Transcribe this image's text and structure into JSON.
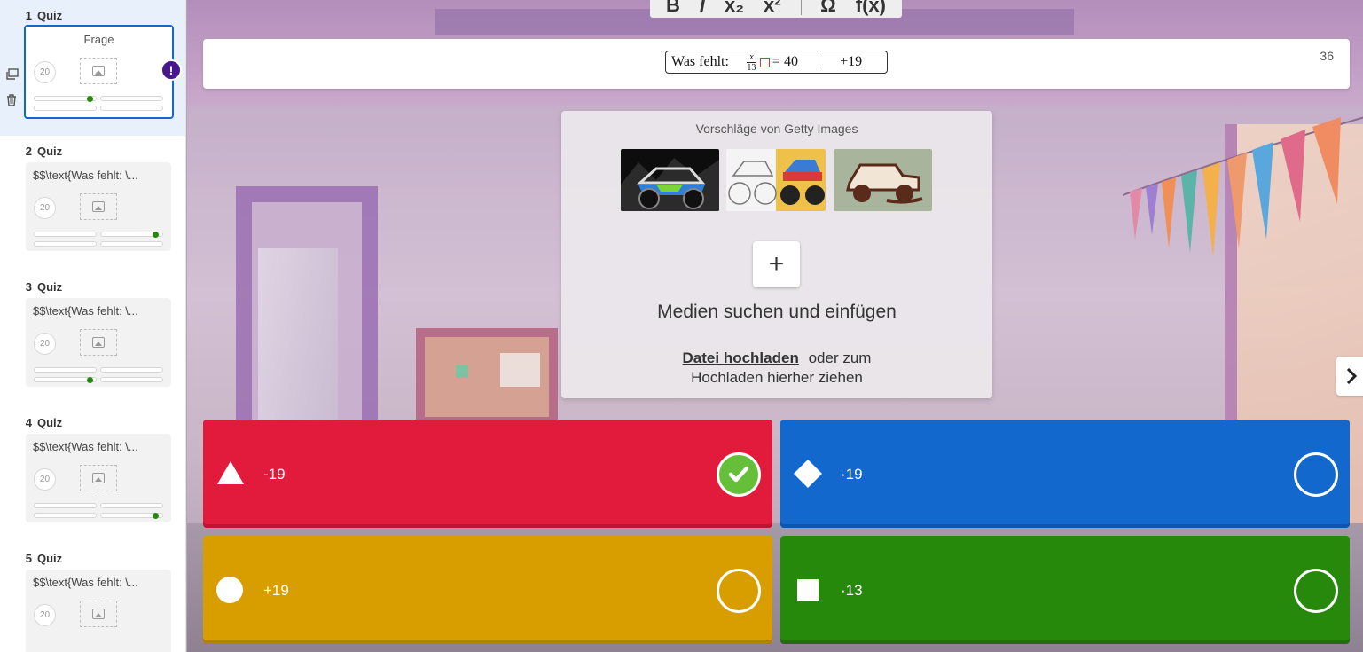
{
  "toolbar": {
    "bold": "B",
    "italic": "I",
    "subscript": "x₂",
    "superscript": "x²",
    "special_chars": "Ω",
    "function": "f(x)"
  },
  "sidebar": {
    "slides": [
      {
        "number": "1",
        "type": "Quiz",
        "title": "Frage",
        "timer": "20",
        "has_warning": true,
        "warning_label": "!"
      },
      {
        "number": "2",
        "type": "Quiz",
        "title": "$$\\text{Was fehlt: \\...",
        "timer": "20"
      },
      {
        "number": "3",
        "type": "Quiz",
        "title": "$$\\text{Was fehlt: \\...",
        "timer": "20"
      },
      {
        "number": "4",
        "type": "Quiz",
        "title": "$$\\text{Was fehlt: \\...",
        "timer": "20"
      },
      {
        "number": "5",
        "type": "Quiz",
        "title": "$$\\text{Was fehlt: \\...",
        "timer": "20"
      }
    ]
  },
  "question": {
    "prefix": "Was fehlt:",
    "frac_num": "x",
    "frac_den": "13",
    "equation_rest": "= 40",
    "separator": "|",
    "hint": "+19",
    "char_count": "36"
  },
  "media": {
    "suggestions_label": "Vorschläge von Getty Images",
    "add_symbol": "+",
    "title": "Medien suchen und einfügen",
    "upload_link": "Datei hochladen",
    "upload_rest_1": "oder zum",
    "upload_rest_2": "Hochladen hierher ziehen"
  },
  "answers": [
    {
      "shape": "triangle",
      "text": "-19",
      "correct": true,
      "color": "#e21b3c"
    },
    {
      "shape": "diamond",
      "text": "·19",
      "correct": false,
      "color": "#1368ce"
    },
    {
      "shape": "circle",
      "text": "+19",
      "correct": false,
      "color": "#d89e00"
    },
    {
      "shape": "square",
      "text": "·13",
      "correct": false,
      "color": "#26890c"
    }
  ],
  "colors": {
    "accent": "#1368ce",
    "warning": "#46178f",
    "correct_check": "#66bf39"
  }
}
